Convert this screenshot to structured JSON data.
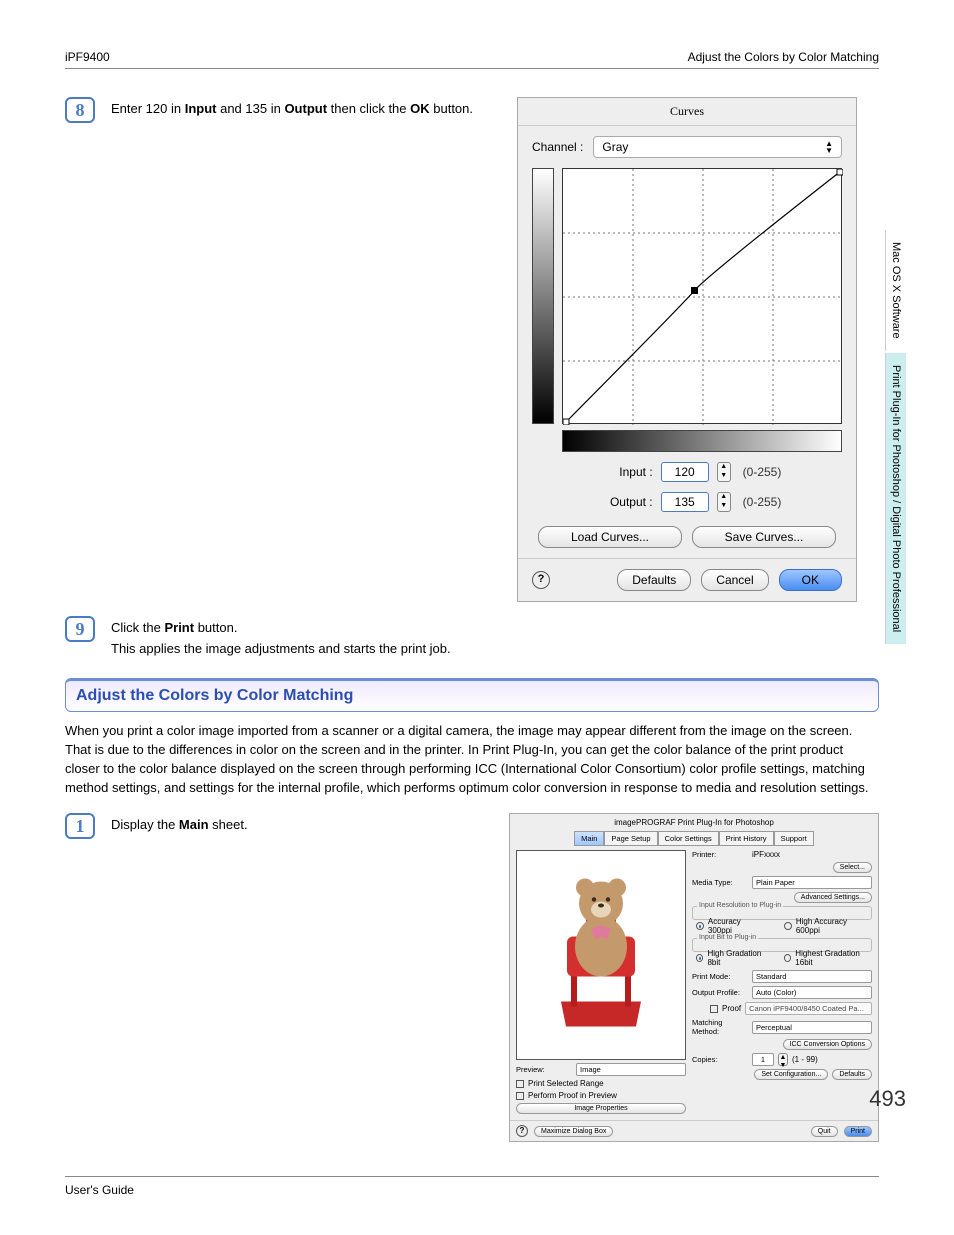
{
  "header": {
    "left": "iPF9400",
    "right": "Adjust the Colors by Color Matching"
  },
  "sideTabs": {
    "a": "Mac OS X Software",
    "b": "Print Plug-In for Photoshop / Digital Photo Professional"
  },
  "steps": {
    "s8": {
      "num": "8",
      "text_a": "Enter 120 in ",
      "text_b": " and 135 in ",
      "text_c": " then click the ",
      "text_d": " button.",
      "inputLabel": "Input",
      "outputLabel": "Output",
      "okLabel": "OK"
    },
    "s9": {
      "num": "9",
      "line1a": "Click the ",
      "line1b": " button.",
      "printLabel": "Print",
      "line2": "This applies the image adjustments and starts the print job."
    },
    "s1": {
      "num": "1",
      "text_a": "Display the ",
      "text_b": " sheet.",
      "mainLabel": "Main"
    }
  },
  "curves": {
    "title": "Curves",
    "channelLabel": "Channel :",
    "channelValue": "Gray",
    "inputLabel": "Input :",
    "inputValue": "120",
    "outputLabel": "Output :",
    "outputValue": "135",
    "rangeHint": "(0-255)",
    "loadCurves": "Load Curves...",
    "saveCurves": "Save Curves...",
    "defaults": "Defaults",
    "cancel": "Cancel",
    "ok": "OK"
  },
  "section": {
    "title": "Adjust the Colors by Color Matching",
    "body": "When you print a color image imported from a scanner or a digital camera, the image may appear different from the image on the screen. That is due to the differences in color on the screen and in the printer. In Print Plug-In, you can get the color balance of the print product closer to the color balance displayed on the screen through performing ICC (International Color Consortium) color profile settings, matching method settings, and settings for the internal profile, which performs optimum color conversion in response to media and resolution settings."
  },
  "plugin": {
    "windowTitle": "imagePROGRAF Print Plug-In for Photoshop",
    "tabs": [
      "Main",
      "Page Setup",
      "Color Settings",
      "Print History",
      "Support"
    ],
    "previewLabel": "Preview:",
    "previewMode": "Image",
    "printSelected": "Print Selected Range",
    "performProof": "Perform Proof in Preview",
    "imageProps": "Image Properties",
    "maximize": "Maximize Dialog Box",
    "printerLabel": "Printer:",
    "printerValue": "iPFxxxx",
    "select": "Select...",
    "mediaLabel": "Media Type:",
    "mediaValue": "Plain Paper",
    "advanced": "Advanced Settings...",
    "inputResTitle": "Input Resolution to Plug-in",
    "acc300": "Accuracy 300ppi",
    "acc600": "High Accuracy 600ppi",
    "bitTitle": "Input Bit to Plug-in",
    "bit8": "High Gradation 8bit",
    "bit16": "Highest Gradation 16bit",
    "printModeLabel": "Print Mode:",
    "printModeValue": "Standard",
    "outputProfileLabel": "Output Profile:",
    "outputProfileValue": "Auto (Color)",
    "proofLabel": "Proof",
    "proofValue": "Canon iPF9400/8450 Coated Pa...",
    "matchingLabel": "Matching Method:",
    "matchingValue": "Perceptual",
    "iccOptions": "ICC Conversion Options",
    "copiesLabel": "Copies:",
    "copiesValue": "1",
    "copiesRange": "(1 - 99)",
    "setConfig": "Set Configuration...",
    "defaults": "Defaults",
    "quit": "Quit",
    "print": "Print"
  },
  "footer": {
    "guide": "User's Guide",
    "pageNum": "493"
  }
}
